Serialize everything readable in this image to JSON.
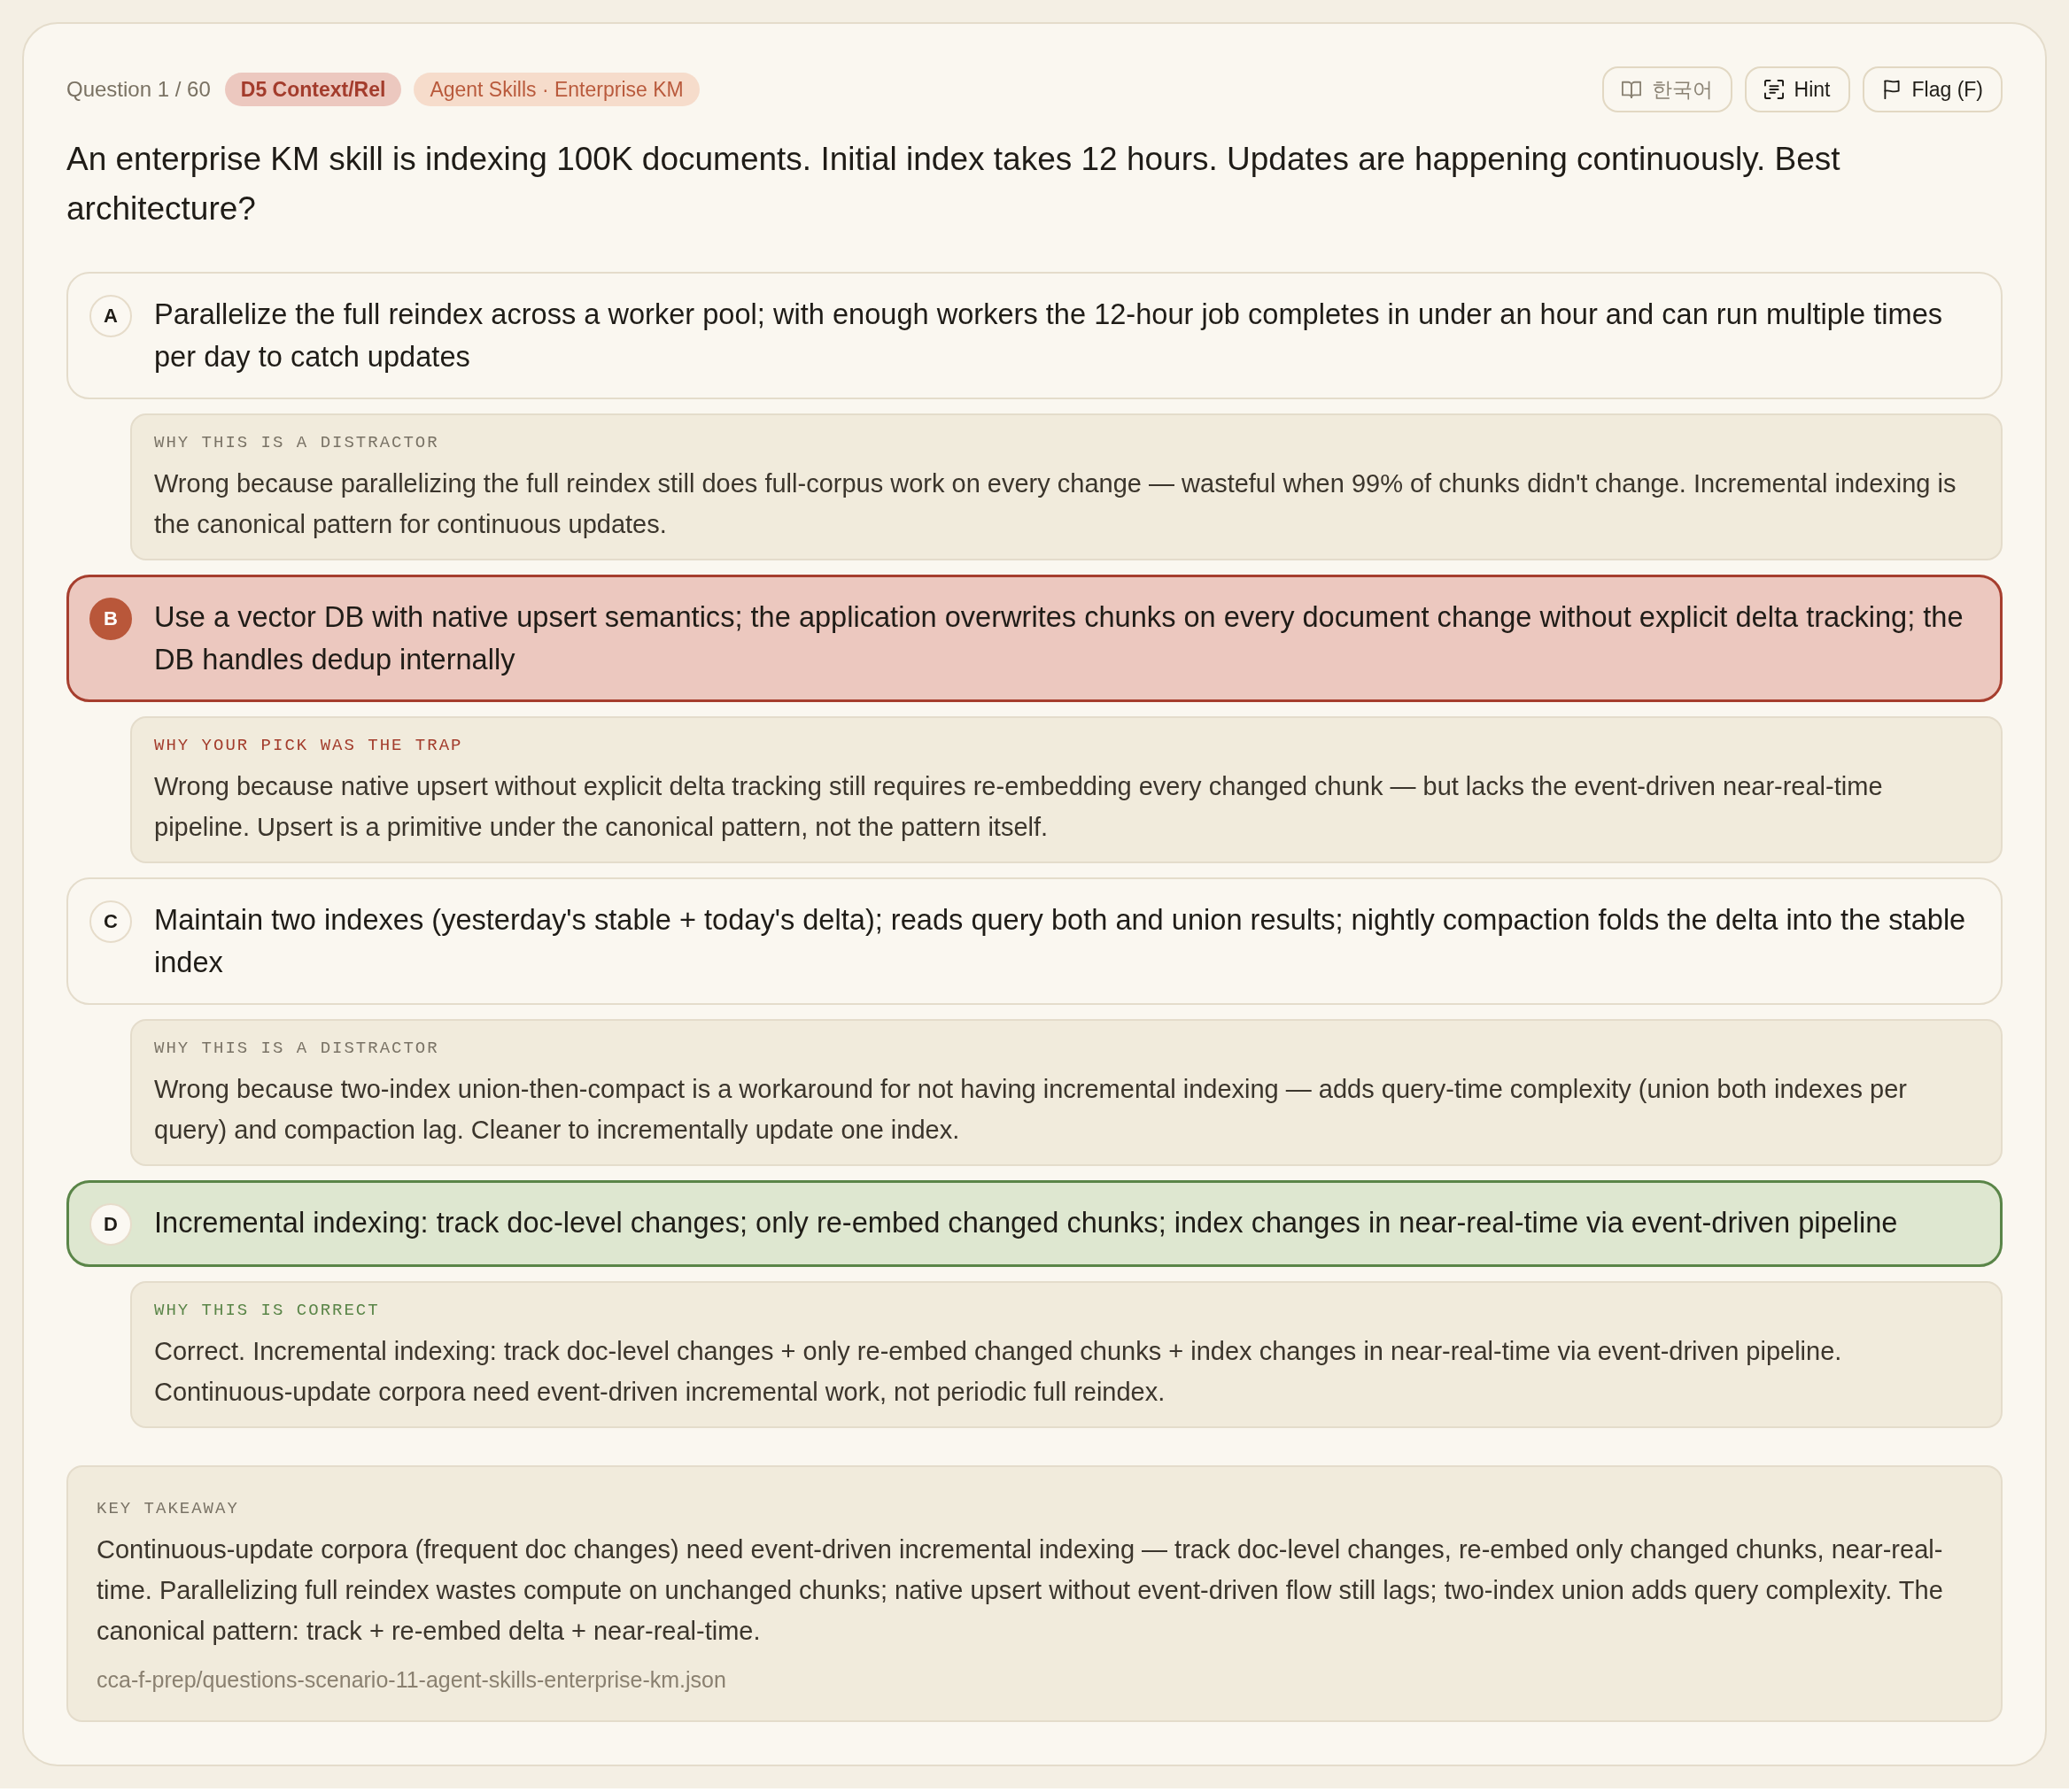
{
  "header": {
    "counter": "Question 1 / 60",
    "tags": [
      {
        "label": "D5 Context/Rel",
        "kind": "domain"
      },
      {
        "label": "Agent Skills · Enterprise KM",
        "kind": "scenario"
      }
    ],
    "buttons": [
      {
        "label": "한국어",
        "kind": "language",
        "disabled": true
      },
      {
        "label": "Hint",
        "kind": "hint",
        "disabled": false
      },
      {
        "label": "Flag (F)",
        "kind": "flag",
        "disabled": false
      }
    ]
  },
  "question": "An enterprise KM skill is indexing 100K documents. Initial index takes 12 hours. Updates are happening continuously. Best architecture?",
  "options": [
    {
      "letter": "A",
      "text": "Parallelize the full reindex across a worker pool; with enough workers the 12-hour job completes in under an hour and can run multiple times per day to catch updates",
      "selected": false,
      "correct": false,
      "explanation": {
        "label": "WHY THIS IS A DISTRACTOR",
        "text": "Wrong because parallelizing the full reindex still does full-corpus work on every change — wasteful when 99% of chunks didn't change. Incremental indexing is the canonical pattern for continuous updates."
      }
    },
    {
      "letter": "B",
      "text": "Use a vector DB with native upsert semantics; the application overwrites chunks on every document change without explicit delta tracking; the DB handles dedup internally",
      "selected": true,
      "correct": false,
      "explanation": {
        "label": "WHY YOUR PICK WAS THE TRAP",
        "text": "Wrong because native upsert without explicit delta tracking still requires re-embedding every changed chunk — but lacks the event-driven near-real-time pipeline. Upsert is a primitive under the canonical pattern, not the pattern itself."
      }
    },
    {
      "letter": "C",
      "text": "Maintain two indexes (yesterday's stable + today's delta); reads query both and union results; nightly compaction folds the delta into the stable index",
      "selected": false,
      "correct": false,
      "explanation": {
        "label": "WHY THIS IS A DISTRACTOR",
        "text": "Wrong because two-index union-then-compact is a workaround for not having incremental indexing — adds query-time complexity (union both indexes per query) and compaction lag. Cleaner to incrementally update one index."
      }
    },
    {
      "letter": "D",
      "text": "Incremental indexing: track doc-level changes; only re-embed changed chunks; index changes in near-real-time via event-driven pipeline",
      "selected": false,
      "correct": true,
      "explanation": {
        "label": "WHY THIS IS CORRECT",
        "text": "Correct. Incremental indexing: track doc-level changes + only re-embed changed chunks + index changes in near-real-time via event-driven pipeline. Continuous-update corpora need event-driven incremental work, not periodic full reindex."
      }
    }
  ],
  "takeaway": {
    "label": "KEY TAKEAWAY",
    "text": "Continuous-update corpora (frequent doc changes) need event-driven incremental indexing — track doc-level changes, re-embed only changed chunks, near-real-time. Parallelizing full reindex wastes compute on unchanged chunks; native upsert without event-driven flow still lags; two-index union adds query complexity. The canonical pattern: track + re-embed delta + near-real-time.",
    "source": "cca-f-prep/questions-scenario-11-agent-skills-enterprise-km.json"
  }
}
